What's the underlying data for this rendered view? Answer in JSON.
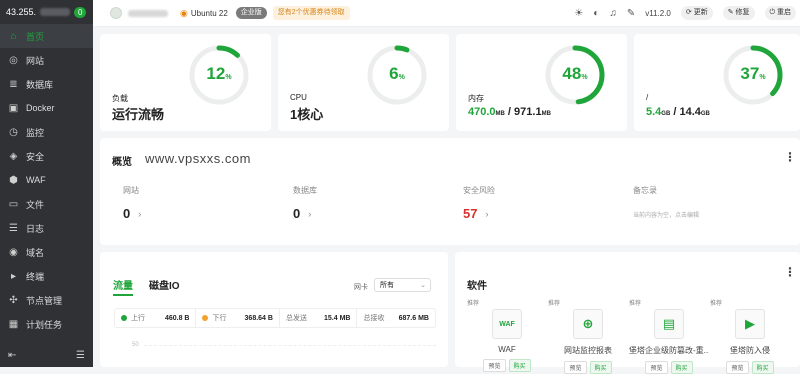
{
  "sidebar": {
    "ip": "43.255.",
    "count": "0",
    "items": [
      {
        "label": "首页",
        "icon": "home-icon",
        "glyph": "⌂"
      },
      {
        "label": "网站",
        "icon": "globe-icon",
        "glyph": "◎"
      },
      {
        "label": "数据库",
        "icon": "database-icon",
        "glyph": "≣"
      },
      {
        "label": "Docker",
        "icon": "docker-icon",
        "glyph": "▣"
      },
      {
        "label": "监控",
        "icon": "monitor-icon",
        "glyph": "◷"
      },
      {
        "label": "安全",
        "icon": "shield-icon",
        "glyph": "◈"
      },
      {
        "label": "WAF",
        "icon": "waf-icon",
        "glyph": "⬢"
      },
      {
        "label": "文件",
        "icon": "folder-icon",
        "glyph": "▭"
      },
      {
        "label": "日志",
        "icon": "log-icon",
        "glyph": "☰"
      },
      {
        "label": "域名",
        "icon": "domain-icon",
        "glyph": "◉"
      },
      {
        "label": "终端",
        "icon": "terminal-icon",
        "glyph": "▸"
      },
      {
        "label": "节点管理",
        "icon": "node-icon",
        "glyph": "✣"
      },
      {
        "label": "计划任务",
        "icon": "calendar-icon",
        "glyph": "▦"
      }
    ]
  },
  "topbar": {
    "os": "Ubuntu 22",
    "edition": "企业版",
    "promo": "您有2个优惠券待领取",
    "version": "v11.2.0",
    "update": "更新",
    "repair": "修复",
    "restart": "重启"
  },
  "stats": {
    "load": {
      "label": "负载",
      "value": "运行流畅",
      "percent": 12
    },
    "cpu": {
      "label": "CPU",
      "value": "1核心",
      "percent": 6
    },
    "mem": {
      "label": "内存",
      "used": "470.0",
      "used_unit": "MB",
      "total": "971.1",
      "total_unit": "MB",
      "percent": 48
    },
    "disk": {
      "label": "/",
      "used": "5.4",
      "used_unit": "GB",
      "total": "14.4",
      "total_unit": "GB",
      "percent": 37
    }
  },
  "overview": {
    "title": "概览",
    "domain": "www.vpsxxs.com",
    "sites_label": "网站",
    "sites": "0",
    "db_label": "数据库",
    "db": "0",
    "risk_label": "安全风险",
    "risk": "57",
    "memo_label": "备忘录",
    "memo_hint": "当前内容为空，点击编辑"
  },
  "traffic": {
    "tab_flow": "流量",
    "tab_io": "磁盘IO",
    "nic_label": "网卡",
    "nic_value": "所有",
    "up_label": "上行",
    "up": "460.8 B",
    "down_label": "下行",
    "down": "368.64 B",
    "sent_label": "总发送",
    "sent": "15.4 MB",
    "recv_label": "总接收",
    "recv": "687.6 MB",
    "tick": "50"
  },
  "software": {
    "title": "软件",
    "items": [
      {
        "tag": "推荐",
        "name": "WAF",
        "preview": "预览",
        "buy": "购买",
        "icon": "waf-shield-icon"
      },
      {
        "tag": "推荐",
        "name": "网站监控报表",
        "preview": "预览",
        "buy": "购买",
        "icon": "site-monitor-icon"
      },
      {
        "tag": "推荐",
        "name": "堡塔企业级防篡改-重...",
        "preview": "预览",
        "buy": "购买",
        "icon": "tamper-proof-icon"
      },
      {
        "tag": "推荐",
        "name": "堡塔防入侵",
        "preview": "预览",
        "buy": "购买",
        "icon": "intrusion-icon"
      }
    ]
  },
  "colors": {
    "accent": "#20a53a",
    "danger": "#d9312e",
    "sidebar": "#2f3135"
  }
}
